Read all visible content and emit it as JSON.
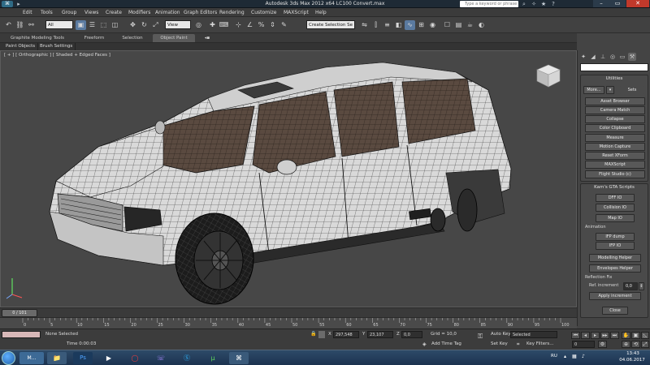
{
  "window": {
    "title": "Autodesk 3ds Max  2012 x64      LC100 Convert.max",
    "search_placeholder": "Type a keyword or phrase",
    "controls": [
      "–",
      "▭",
      "✕"
    ]
  },
  "menu": [
    "Edit",
    "Tools",
    "Group",
    "Views",
    "Create",
    "Modifiers",
    "Animation",
    "Graph Editors",
    "Rendering",
    "Customize",
    "MAXScript",
    "Help"
  ],
  "toolbar": {
    "selection_filter": "All",
    "reference_coord": "View",
    "named_selection": "Create Selection Se"
  },
  "ribbon": {
    "tabs": [
      "Graphite Modeling Tools",
      "Freeform",
      "Selection",
      "Object Paint"
    ],
    "active_tab": "Object Paint",
    "sub_tabs": [
      "Paint Objects",
      "Brush Settings"
    ]
  },
  "viewport": {
    "label": "[ + ] [ Orthographic ] [ Shaded + Edged Faces ]"
  },
  "command_panel": {
    "utilities": {
      "title": "Utilities",
      "more_label": "More...",
      "sets_label": "Sets",
      "buttons": [
        "Asset Browser",
        "Camera Match",
        "Collapse",
        "Color Clipboard",
        "Measure",
        "Motion Capture",
        "Reset XForm",
        "MAXScript",
        "Flight Studio (c)"
      ]
    },
    "scripts": {
      "title": "Kam's GTA Scripts",
      "buttons": [
        "DFF IO",
        "Collision IO",
        "Map IO"
      ],
      "animation_label": "Animation",
      "anim_buttons": [
        "IFP dump",
        "IFP IO"
      ],
      "modelling_helper": "Modelling Helper",
      "envelopes_helper": "Envelopes Helper",
      "reflection_label": "Reflection Fix",
      "ref_increment_label": "Ref. increment",
      "ref_increment_value": "0,0",
      "apply_increment": "Apply increment",
      "close": "Close"
    }
  },
  "timeline": {
    "frame_display": "0 / 101",
    "ticks": [
      "0",
      "5",
      "10",
      "15",
      "20",
      "25",
      "30",
      "35",
      "40",
      "45",
      "50",
      "55",
      "60",
      "65",
      "70",
      "75",
      "80",
      "85",
      "90",
      "95",
      "100"
    ]
  },
  "status": {
    "selection_status": "None Selected",
    "time_label": "Time 0:00:03",
    "x_label": "X",
    "x_value": "297,548",
    "y_label": "Y",
    "y_value": "23,107",
    "z_label": "Z",
    "z_value": "0,0",
    "grid": "Grid = 10,0",
    "add_time_tag": "Add Time Tag",
    "auto_key": "Auto Key",
    "set_key": "Set Key",
    "key_mode": "Selected",
    "key_filters": "Key Filters...",
    "frame_value": "0"
  },
  "taskbar": {
    "language": "RU",
    "time": "13:43",
    "date": "04.06.2017",
    "active_task": "M..."
  }
}
